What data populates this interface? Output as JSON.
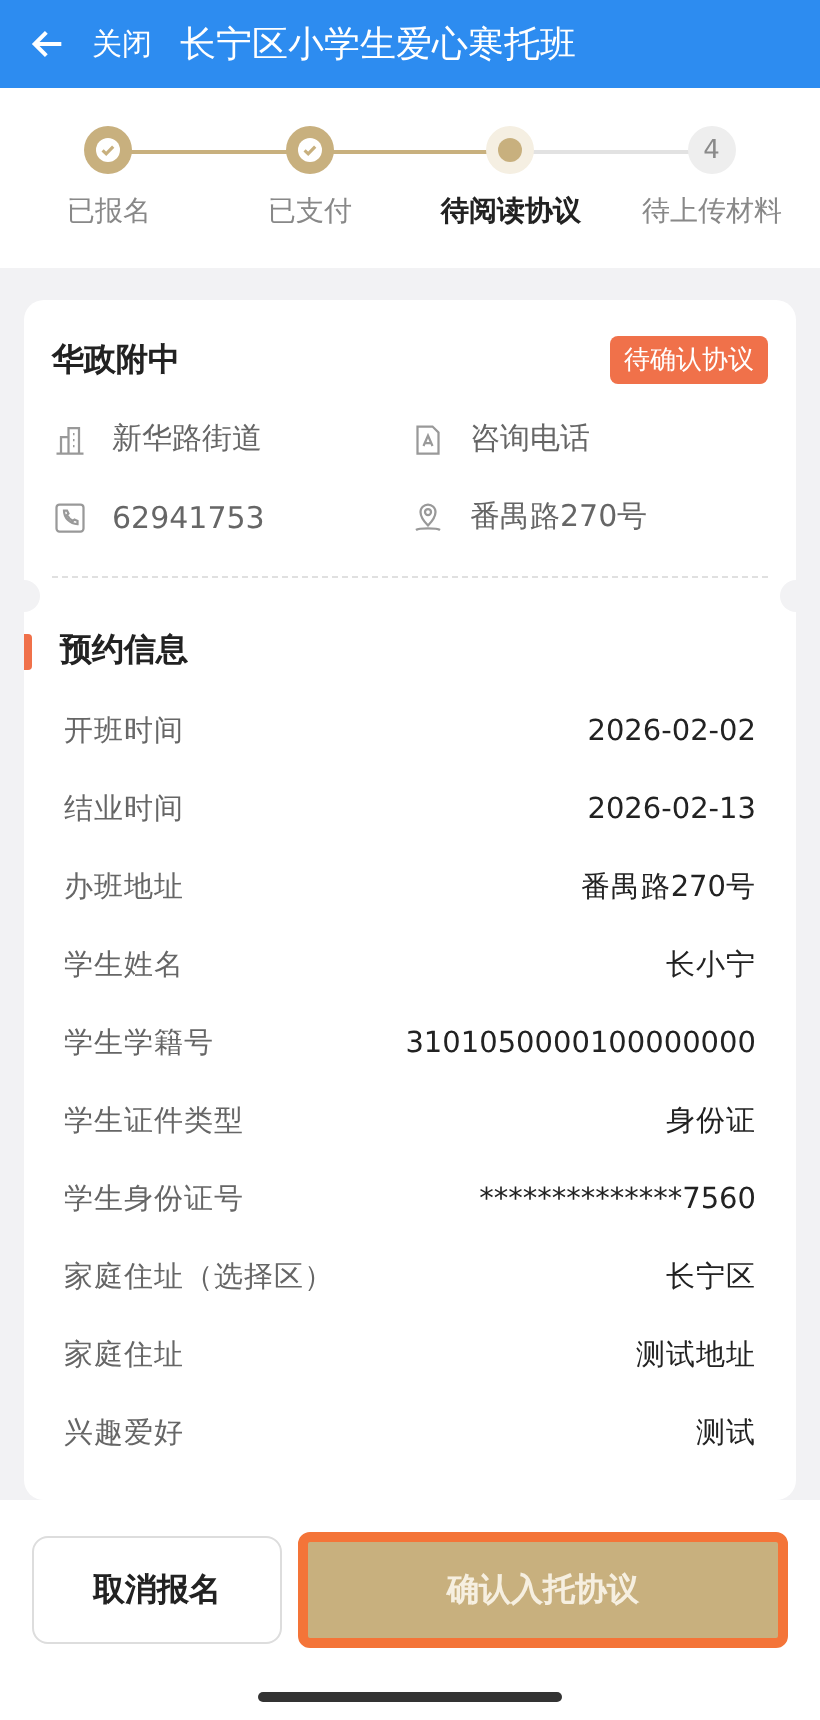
{
  "header": {
    "back_label": "关闭",
    "title": "长宁区小学生爱心寒托班"
  },
  "steps": [
    {
      "label": "已报名",
      "completed": true,
      "selected": false
    },
    {
      "label": "已支付",
      "completed": true,
      "selected": false
    },
    {
      "label": "待阅读协议",
      "completed": false,
      "selected": true
    },
    {
      "label": "待上传材料",
      "completed": false,
      "selected": false,
      "number": "4"
    }
  ],
  "school": {
    "name": "华政附中",
    "badge": "待确认协议",
    "details": [
      {
        "kind": "building",
        "text": "新华路街道"
      },
      {
        "kind": "contact",
        "text": "咨询电话"
      },
      {
        "kind": "phone",
        "text": "62941753"
      },
      {
        "kind": "location",
        "text": "番禺路270号"
      }
    ]
  },
  "booking": {
    "title": "预约信息",
    "rows": [
      {
        "label": "开班时间",
        "value": "2026-02-02"
      },
      {
        "label": "结业时间",
        "value": "2026-02-13"
      },
      {
        "label": "办班地址",
        "value": "番禺路270号"
      },
      {
        "label": "学生姓名",
        "value": "长小宁"
      },
      {
        "label": "学生学籍号",
        "value": "3101050000100000000"
      },
      {
        "label": "学生证件类型",
        "value": "身份证"
      },
      {
        "label": "学生身份证号",
        "value": "**************7560"
      },
      {
        "label": "家庭住址（选择区）",
        "value": "长宁区"
      },
      {
        "label": "家庭住址",
        "value": "测试地址"
      },
      {
        "label": "兴趣爱好",
        "value": "测试"
      }
    ]
  },
  "actions": {
    "cancel": "取消报名",
    "confirm": "确认入托协议",
    "confirm_highlighted": true
  }
}
